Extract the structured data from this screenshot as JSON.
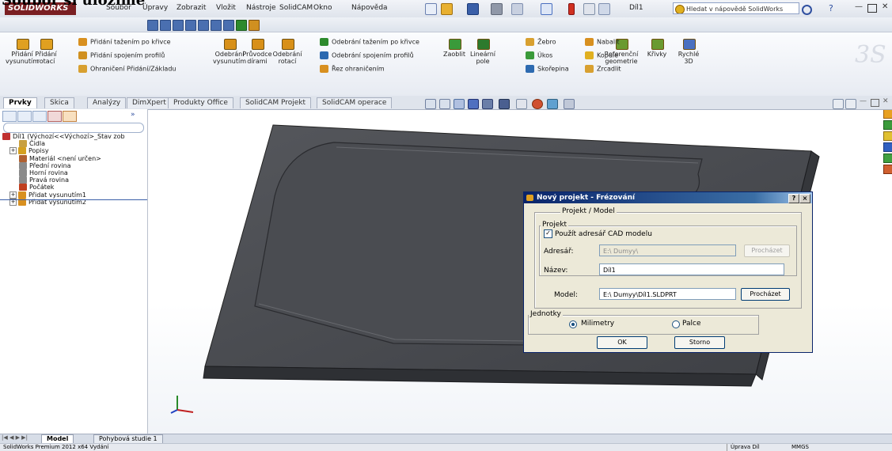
{
  "caption": "Soubor si uložíme",
  "app": {
    "logo": "SOLIDWORKS",
    "menu": [
      "Soubor",
      "Úpravy",
      "Zobrazit",
      "Vložit",
      "Nástroje",
      "SolidCAM",
      "Okno",
      "Nápověda"
    ],
    "document_name": "Díl1",
    "help_search": "Hledat v nápovědě SolidWorks"
  },
  "commands": {
    "big": [
      {
        "label": "Přidání\nvysunutím",
        "color": "#e0a020"
      },
      {
        "label": "Přidání\nrotací",
        "color": "#e0a020"
      },
      {
        "label": "Odebrání\nvysunutím",
        "color": "#d89018"
      },
      {
        "label": "Průvodce\ndírami",
        "color": "#d89018"
      },
      {
        "label": "Odebrání\nrotací",
        "color": "#d89018"
      },
      {
        "label": "Zaoblit",
        "color": "#3a9a3a"
      },
      {
        "label": "Lineární\npole",
        "color": "#2d7a2d"
      },
      {
        "label": "Referenční\ngeometrie",
        "color": "#6a9a30"
      },
      {
        "label": "Křivky",
        "color": "#6a9a30"
      },
      {
        "label": "Rychlé\n3D",
        "color": "#4a70c0"
      }
    ],
    "small_col1": [
      "Přidání tažením po křivce",
      "Přidání spojením profilů",
      "Ohraničení Přidání/Základu"
    ],
    "small_col2": [
      "Odebrání tažením po křivce",
      "Odebrání spojením profilů",
      "Řez ohraničením"
    ],
    "small_col3": [
      "Žebro",
      "Úkos",
      "Skořepina"
    ],
    "small_col4": [
      "Nabalit",
      "Kopule",
      "Zrcadlit"
    ]
  },
  "tabs": [
    "Prvky",
    "Skica",
    "Analýzy",
    "DimXpert",
    "Produkty Office",
    "SolidCAM Projekt",
    "SolidCAM operace"
  ],
  "tree": [
    {
      "text": "Díl1  (Výchozí<<Výchozí>_Stav zob",
      "color": "#c03030",
      "exp": ""
    },
    {
      "text": "Čidla",
      "color": "#c8a040",
      "exp": ""
    },
    {
      "text": "Popisy",
      "color": "#d4a020",
      "exp": "+"
    },
    {
      "text": "Materiál <není určen>",
      "color": "#b06030",
      "exp": ""
    },
    {
      "text": "Přední rovina",
      "color": "#8a8a8a",
      "exp": ""
    },
    {
      "text": "Horní rovina",
      "color": "#8a8a8a",
      "exp": ""
    },
    {
      "text": "Pravá rovina",
      "color": "#8a8a8a",
      "exp": ""
    },
    {
      "text": "Počátek",
      "color": "#c04020",
      "exp": ""
    },
    {
      "text": "Přidat vysunutím1",
      "color": "#d89020",
      "exp": "+"
    },
    {
      "text": "Přidat vysunutím2",
      "color": "#d89020",
      "exp": "+"
    }
  ],
  "bottom_tabs": [
    "Model",
    "Pohybová studie 1"
  ],
  "status": {
    "left": "SolidWorks Premium 2012 x64 Vydání",
    "mid": "Úprava Díl",
    "right": "MMGS"
  },
  "dialog": {
    "title": "Nový projekt - Frézování",
    "help_btn": "?",
    "close_btn": "×",
    "group_outer": "Projekt / Model",
    "group_project": "Projekt",
    "use_cad_dir": "Použít adresář CAD modelu",
    "use_cad_checked": "✓",
    "dir_label": "Adresář:",
    "dir_value": "E:\\ Dumyy\\",
    "browse1": "Procházet",
    "name_label": "Název:",
    "name_value": "Díl1",
    "model_label": "Model:",
    "model_value": "E:\\ Dumyy\\Díl1.SLDPRT",
    "browse2": "Procházet",
    "units_group": "Jednotky",
    "unit_mm": "Milimetry",
    "unit_in": "Palce",
    "ok": "OK",
    "cancel": "Storno"
  }
}
